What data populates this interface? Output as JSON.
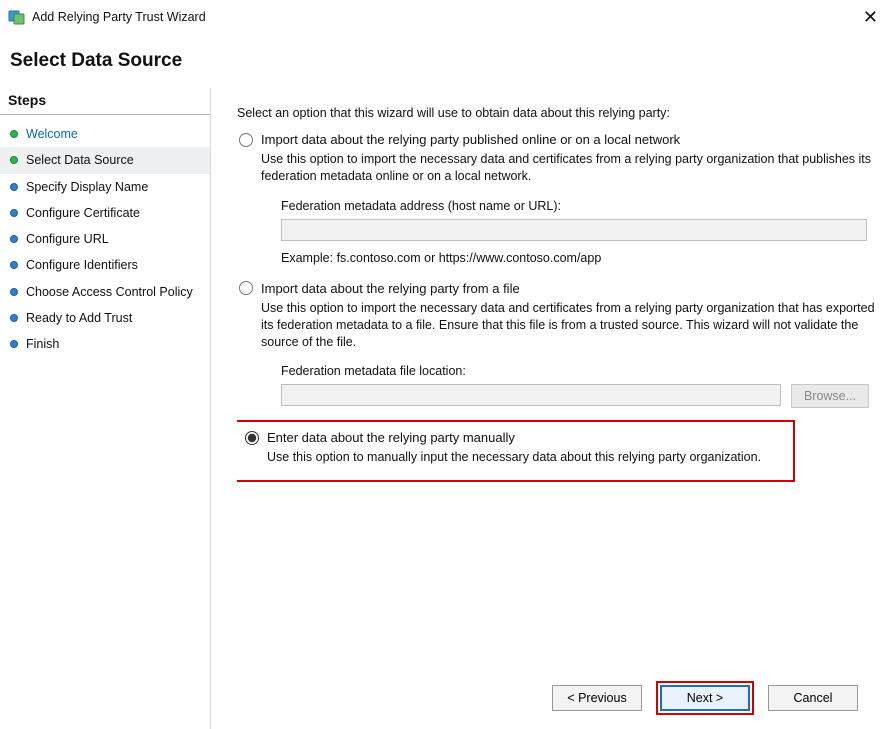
{
  "window": {
    "title": "Add Relying Party Trust Wizard",
    "close_glyph": "✕"
  },
  "heading": "Select Data Source",
  "sidebar": {
    "title": "Steps",
    "items": [
      {
        "label": "Welcome",
        "bullet": "green",
        "link": true,
        "selected": false
      },
      {
        "label": "Select Data Source",
        "bullet": "green",
        "link": false,
        "selected": true
      },
      {
        "label": "Specify Display Name",
        "bullet": "blue",
        "link": false,
        "selected": false
      },
      {
        "label": "Configure Certificate",
        "bullet": "blue",
        "link": false,
        "selected": false
      },
      {
        "label": "Configure URL",
        "bullet": "blue",
        "link": false,
        "selected": false
      },
      {
        "label": "Configure Identifiers",
        "bullet": "blue",
        "link": false,
        "selected": false
      },
      {
        "label": "Choose Access Control Policy",
        "bullet": "blue",
        "link": false,
        "selected": false
      },
      {
        "label": "Ready to Add Trust",
        "bullet": "blue",
        "link": false,
        "selected": false
      },
      {
        "label": "Finish",
        "bullet": "blue",
        "link": false,
        "selected": false
      }
    ]
  },
  "content": {
    "intro": "Select an option that this wizard will use to obtain data about this relying party:",
    "option_online": {
      "label": "Import data about the relying party published online or on a local network",
      "desc": "Use this option to import the necessary data and certificates from a relying party organization that publishes its federation metadata online or on a local network.",
      "field_label": "Federation metadata address (host name or URL):",
      "field_value": "",
      "example": "Example: fs.contoso.com or https://www.contoso.com/app",
      "selected": false
    },
    "option_file": {
      "label": "Import data about the relying party from a file",
      "desc": "Use this option to import the necessary data and certificates from a relying party organization that has exported its federation metadata to a file. Ensure that this file is from a trusted source.  This wizard will not validate the source of the file.",
      "field_label": "Federation metadata file location:",
      "field_value": "",
      "browse_label": "Browse...",
      "selected": false
    },
    "option_manual": {
      "label": "Enter data about the relying party manually",
      "desc": "Use this option to manually input the necessary data about this relying party organization.",
      "selected": true
    }
  },
  "footer": {
    "previous": "< Previous",
    "next": "Next >",
    "cancel": "Cancel"
  }
}
